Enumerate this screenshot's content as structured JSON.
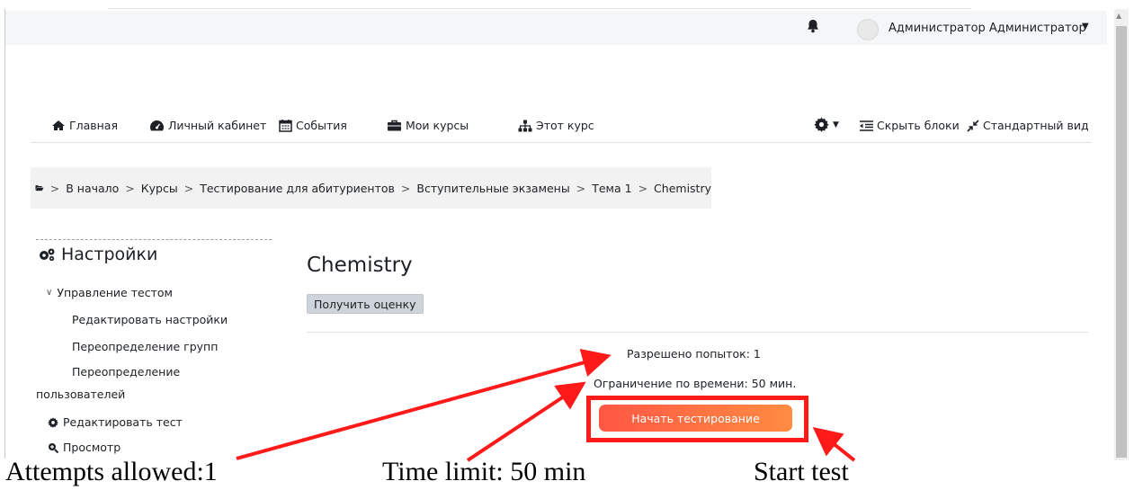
{
  "navbar": {
    "user_name": "Администратор Администратор",
    "icons": [
      "bell-icon",
      "avatar-icon",
      "caret-down-icon"
    ]
  },
  "nav": {
    "items": [
      {
        "label": "Главная",
        "icon": "home-icon"
      },
      {
        "label": "Личный кабинет",
        "icon": "dashboard-icon"
      },
      {
        "label": "События",
        "icon": "calendar-icon"
      },
      {
        "label": "Мои курсы",
        "icon": "briefcase-icon"
      },
      {
        "label": "Этот курс",
        "icon": "sitemap-icon"
      }
    ],
    "hide_blocks": "Скрыть блоки",
    "standard_view": "Стандартный вид"
  },
  "breadcrumb": {
    "items": [
      "В начало",
      "Курсы",
      "Тестирование для абитуриентов",
      "Вступительные экзамены",
      "Тема 1",
      "Chemistry"
    ],
    "separator": ">"
  },
  "sidebar": {
    "title": "Настройки",
    "section": "Управление тестом",
    "items": [
      "Редактировать настройки",
      "Переопределение групп"
    ],
    "override_users_line1": "Переопределение",
    "override_users_line2": "пользователей",
    "edit_test": "Редактировать тест",
    "preview": "Просмотр"
  },
  "main": {
    "title": "Chemistry",
    "grade_button": "Получить оценку",
    "attempts": "Разрешено попыток: 1",
    "time_limit": "Ограничение по времени: 50 мин.",
    "start_button": "Начать тестирование"
  },
  "annotations": {
    "attempts": "Attempts allowed:1",
    "time_limit": "Time limit: 50 min",
    "start": "Start test",
    "arrow_color": "#ff1a1a"
  },
  "colors": {
    "start_gradient_from": "#ff5744",
    "start_gradient_to": "#ff8c42",
    "highlight_box": "#ff1a1a"
  }
}
